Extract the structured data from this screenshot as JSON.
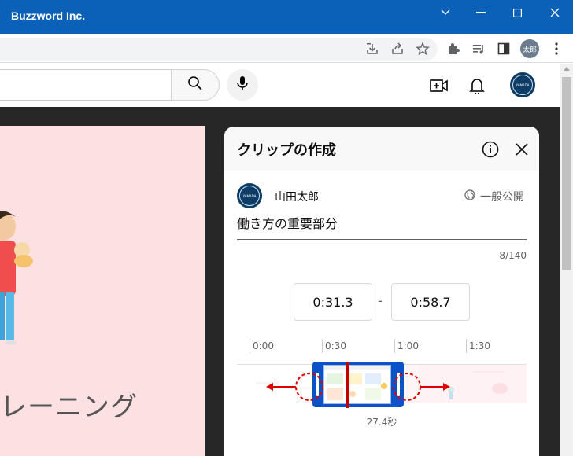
{
  "window": {
    "title": "Buzzword Inc.",
    "controls": [
      "chevron-down-icon",
      "minimize-icon",
      "maximize-icon",
      "close-icon"
    ]
  },
  "browser": {
    "profile_label": "太郎",
    "toolbar_icons": [
      "install-icon",
      "share-icon",
      "bookmark-star-icon",
      "extensions-icon",
      "media-icon",
      "side-panel-icon",
      "menu-icon"
    ]
  },
  "youtube_header": {
    "search_value": "",
    "icons": [
      "search-icon",
      "mic-icon",
      "create-video-icon",
      "bell-icon"
    ],
    "avatar_text": "YAMADA"
  },
  "video": {
    "caption": "レーニング",
    "bg_color": "#fde0e1"
  },
  "clip_panel": {
    "title": "クリップの作成",
    "channel_name": "山田太郎",
    "avatar_text": "YAMADA",
    "visibility": "一般公開",
    "clip_title": "働き方の重要部分",
    "char_count": "8/140",
    "start_time": "0:31.3",
    "separator": "-",
    "end_time": "0:58.7",
    "timeline_labels": [
      "0:00",
      "0:30",
      "1:00",
      "1:30"
    ],
    "duration": "27.4秒",
    "accent_color": "#0b52c9",
    "annotation_color": "#e00000"
  }
}
